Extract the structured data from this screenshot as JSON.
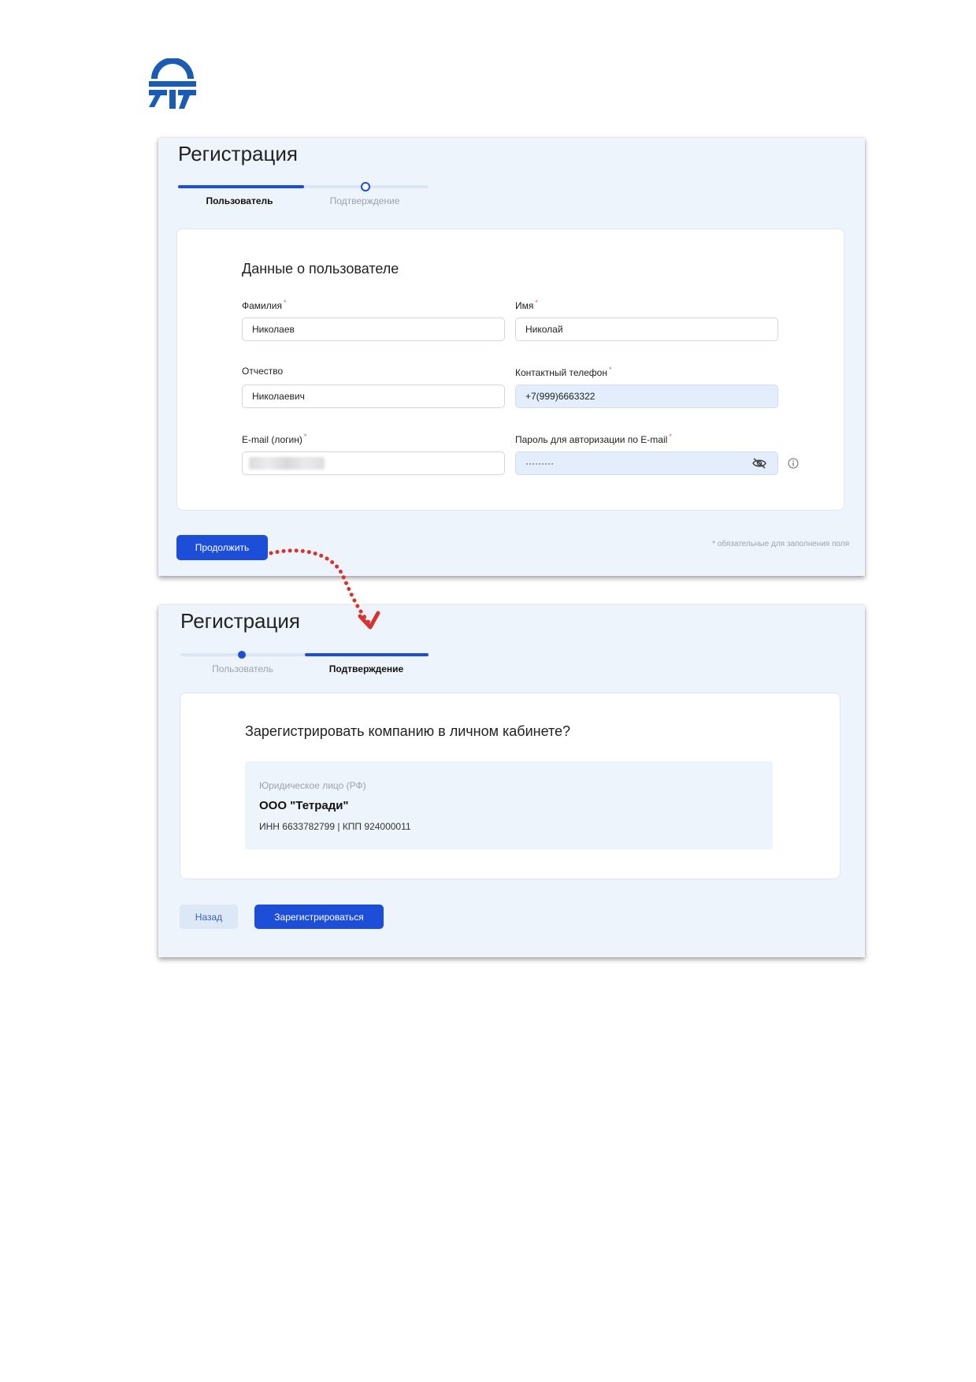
{
  "brand": {
    "logo": "company-logo",
    "color": "#1a5bb5"
  },
  "accent_color": "#1d4ed8",
  "step1": {
    "title": "Регистрация",
    "steps": [
      {
        "label": "Пользователь",
        "active": true
      },
      {
        "label": "Подтверждение",
        "active": false
      }
    ],
    "card_title": "Данные о пользователе",
    "fields": {
      "last_name": {
        "label": "Фамилия",
        "required_mark": "*",
        "value": "Николаев"
      },
      "first_name": {
        "label": "Имя",
        "required_mark": "*",
        "value": "Николай"
      },
      "patronymic": {
        "label": "Отчество",
        "value": "Николаевич"
      },
      "phone": {
        "label": "Контактный телефон",
        "required_mark": "*",
        "value": "+7(999)6663322"
      },
      "email": {
        "label": "E-mail (логин)",
        "required_mark": "*",
        "value": ""
      },
      "password": {
        "label": "Пароль для авторизации по E-mail",
        "required_mark": "*",
        "value": "·········"
      }
    },
    "icons": {
      "password_toggle": "eye-off-icon",
      "password_info": "info-icon"
    },
    "continue_label": "Продолжить",
    "required_note": "* обязательные для заполнения поля"
  },
  "step2": {
    "title": "Регистрация",
    "steps": [
      {
        "label": "Пользователь",
        "active": false
      },
      {
        "label": "Подтверждение",
        "active": true
      }
    ],
    "question": "Зарегистрировать компанию в личном кабинете?",
    "entity": {
      "type": "Юридическое лицо (РФ)",
      "name": "ООО \"Тетради\"",
      "ids": "ИНН 6633782799 | КПП 924000011"
    },
    "back_label": "Назад",
    "register_label": "Зарегистрироваться"
  },
  "flow_arrow": {
    "color": "#d9342b",
    "style": "dotted"
  }
}
